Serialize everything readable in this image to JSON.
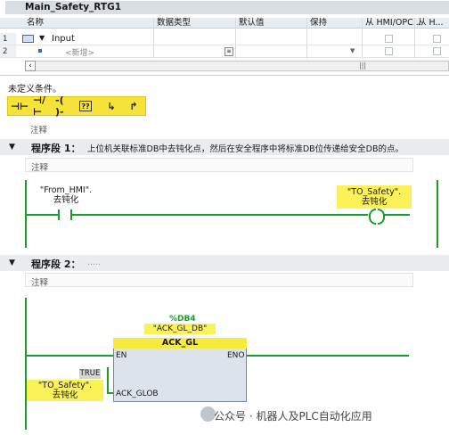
{
  "block": {
    "title": "Main_Safety_RTG1"
  },
  "interface": {
    "columns": [
      "名称",
      "数据类型",
      "默认值",
      "保持",
      "从 HMI/OPC...",
      "从 H..."
    ],
    "rows": [
      {
        "num": "1",
        "name": "Input"
      },
      {
        "num": "2",
        "name": "<新增>"
      }
    ]
  },
  "condition_text": "未定义条件。",
  "toolbar": {
    "buttons": [
      {
        "icon": "no-contact-icon",
        "glyph": "⊣⊢"
      },
      {
        "icon": "nc-contact-icon",
        "glyph": "⊣/⊢"
      },
      {
        "icon": "coil-icon",
        "glyph": "-( )-"
      },
      {
        "icon": "empty-box-icon",
        "glyph": "??"
      },
      {
        "icon": "open-branch-icon",
        "glyph": "↳"
      },
      {
        "icon": "close-branch-icon",
        "glyph": "↱"
      }
    ]
  },
  "segment1": {
    "title": "程序段 1：",
    "description": "上位机关联标准DB中去钝化点，然后在安全程序中将标准DB位传递给安全DB的点。",
    "comment": "注释",
    "contact": {
      "tag": "\"From_HMI\".",
      "name": "去钝化"
    },
    "coil": {
      "tag": "\"TO_Safety\".",
      "name": "去钝化"
    }
  },
  "segment2": {
    "title": "程序段 2：",
    "description": ".....",
    "comment": "注释",
    "instance": {
      "addr": "%DB4",
      "name": "\"ACK_GL_DB\""
    },
    "fb_name": "ACK_GL",
    "pins": {
      "en": "EN",
      "eno": "ENO",
      "ack_glob": "ACK_GLOB"
    },
    "true_label": "TRUE",
    "input_tag": {
      "tag": "\"TO_Safety\".",
      "name": "去钝化"
    }
  },
  "watermark": "公众号 · 机器人及PLC自动化应用",
  "colors": {
    "accent": "#f6ea3d",
    "wire": "#1a9e2a",
    "header": "#e8edf1"
  }
}
